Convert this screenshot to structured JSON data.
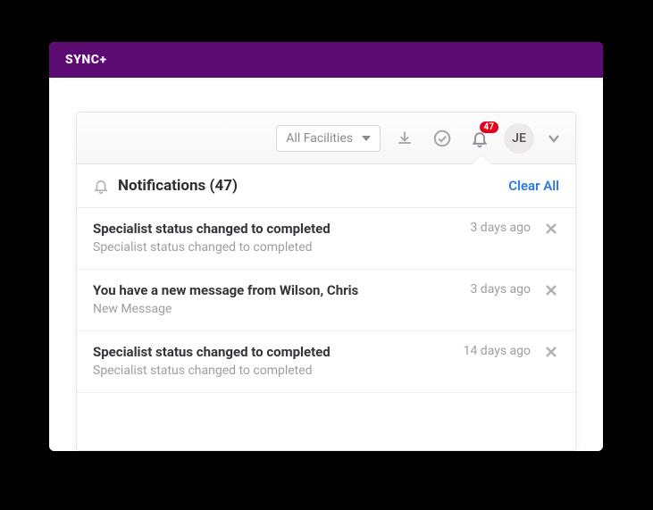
{
  "brand": "SYNC+",
  "header": {
    "dropdown_label": "All Facilities",
    "badge_count": "47",
    "avatar_initials": "JE"
  },
  "notifications": {
    "title": "Notifications (47)",
    "clear_all_label": "Clear All",
    "items": [
      {
        "title": "Specialist status changed to completed",
        "subtitle": "Specialist status changed to completed",
        "time": "3 days ago"
      },
      {
        "title": "You have a new message from Wilson, Chris",
        "subtitle": "New Message",
        "time": "3 days ago"
      },
      {
        "title": "Specialist status changed to completed",
        "subtitle": "Specialist status changed to completed",
        "time": "14 days ago"
      }
    ]
  }
}
